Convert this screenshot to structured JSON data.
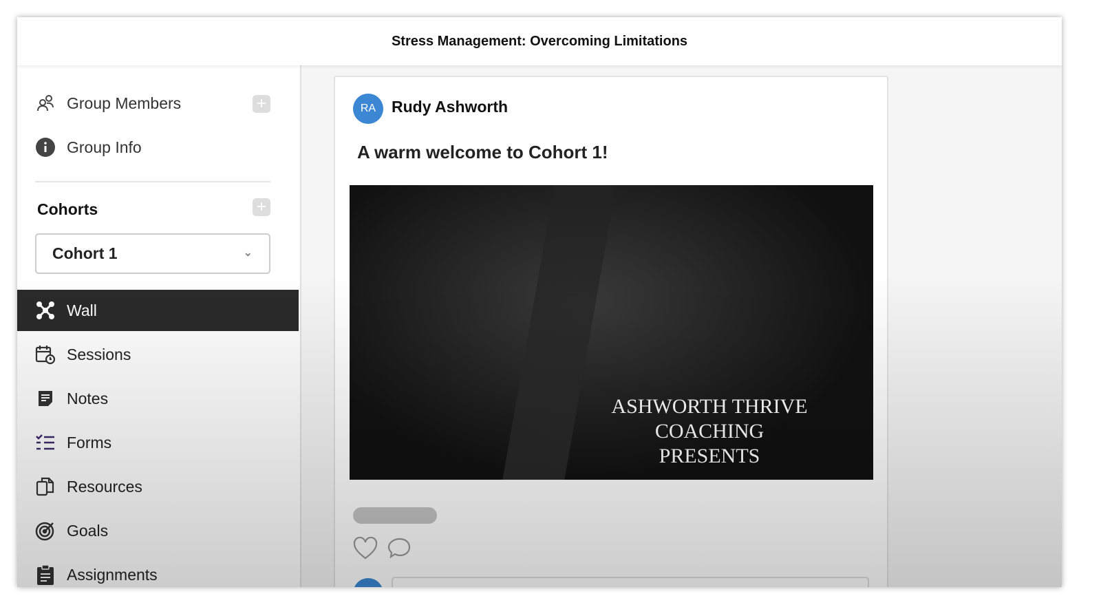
{
  "header": {
    "title": "Stress Management: Overcoming Limitations"
  },
  "sidebar": {
    "group_members": "Group Members",
    "group_info": "Group Info",
    "cohorts_label": "Cohorts",
    "cohort_selected": "Cohort 1",
    "nav": [
      {
        "label": "Wall",
        "icon": "wall-icon",
        "active": true
      },
      {
        "label": "Sessions",
        "icon": "calendar-clock-icon"
      },
      {
        "label": "Notes",
        "icon": "notes-icon"
      },
      {
        "label": "Forms",
        "icon": "forms-icon"
      },
      {
        "label": "Resources",
        "icon": "resources-icon"
      },
      {
        "label": "Goals",
        "icon": "target-icon"
      },
      {
        "label": "Assignments",
        "icon": "clipboard-icon"
      }
    ]
  },
  "post": {
    "author_initials": "RA",
    "author": "Rudy Ashworth",
    "title": "A warm welcome to Cohort 1!",
    "video_caption_line1": "ASHWORTH THRIVE COACHING",
    "video_caption_line2": "PRESENTS"
  },
  "colors": {
    "accent": "#3b87d4",
    "active_nav": "#2a2a2a"
  }
}
